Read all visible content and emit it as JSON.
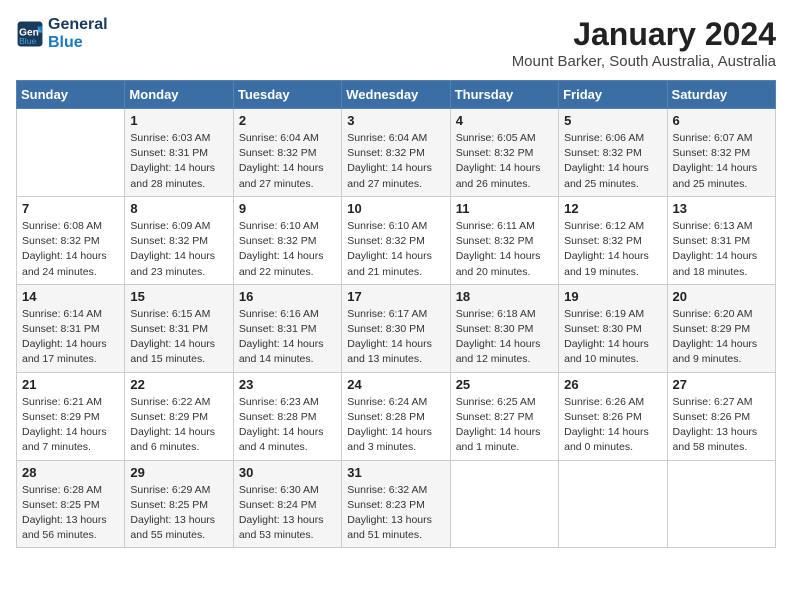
{
  "logo": {
    "line1": "General",
    "line2": "Blue"
  },
  "title": "January 2024",
  "location": "Mount Barker, South Australia, Australia",
  "headers": [
    "Sunday",
    "Monday",
    "Tuesday",
    "Wednesday",
    "Thursday",
    "Friday",
    "Saturday"
  ],
  "weeks": [
    [
      {
        "num": "",
        "info": ""
      },
      {
        "num": "1",
        "info": "Sunrise: 6:03 AM\nSunset: 8:31 PM\nDaylight: 14 hours\nand 28 minutes."
      },
      {
        "num": "2",
        "info": "Sunrise: 6:04 AM\nSunset: 8:32 PM\nDaylight: 14 hours\nand 27 minutes."
      },
      {
        "num": "3",
        "info": "Sunrise: 6:04 AM\nSunset: 8:32 PM\nDaylight: 14 hours\nand 27 minutes."
      },
      {
        "num": "4",
        "info": "Sunrise: 6:05 AM\nSunset: 8:32 PM\nDaylight: 14 hours\nand 26 minutes."
      },
      {
        "num": "5",
        "info": "Sunrise: 6:06 AM\nSunset: 8:32 PM\nDaylight: 14 hours\nand 25 minutes."
      },
      {
        "num": "6",
        "info": "Sunrise: 6:07 AM\nSunset: 8:32 PM\nDaylight: 14 hours\nand 25 minutes."
      }
    ],
    [
      {
        "num": "7",
        "info": "Sunrise: 6:08 AM\nSunset: 8:32 PM\nDaylight: 14 hours\nand 24 minutes."
      },
      {
        "num": "8",
        "info": "Sunrise: 6:09 AM\nSunset: 8:32 PM\nDaylight: 14 hours\nand 23 minutes."
      },
      {
        "num": "9",
        "info": "Sunrise: 6:10 AM\nSunset: 8:32 PM\nDaylight: 14 hours\nand 22 minutes."
      },
      {
        "num": "10",
        "info": "Sunrise: 6:10 AM\nSunset: 8:32 PM\nDaylight: 14 hours\nand 21 minutes."
      },
      {
        "num": "11",
        "info": "Sunrise: 6:11 AM\nSunset: 8:32 PM\nDaylight: 14 hours\nand 20 minutes."
      },
      {
        "num": "12",
        "info": "Sunrise: 6:12 AM\nSunset: 8:32 PM\nDaylight: 14 hours\nand 19 minutes."
      },
      {
        "num": "13",
        "info": "Sunrise: 6:13 AM\nSunset: 8:31 PM\nDaylight: 14 hours\nand 18 minutes."
      }
    ],
    [
      {
        "num": "14",
        "info": "Sunrise: 6:14 AM\nSunset: 8:31 PM\nDaylight: 14 hours\nand 17 minutes."
      },
      {
        "num": "15",
        "info": "Sunrise: 6:15 AM\nSunset: 8:31 PM\nDaylight: 14 hours\nand 15 minutes."
      },
      {
        "num": "16",
        "info": "Sunrise: 6:16 AM\nSunset: 8:31 PM\nDaylight: 14 hours\nand 14 minutes."
      },
      {
        "num": "17",
        "info": "Sunrise: 6:17 AM\nSunset: 8:30 PM\nDaylight: 14 hours\nand 13 minutes."
      },
      {
        "num": "18",
        "info": "Sunrise: 6:18 AM\nSunset: 8:30 PM\nDaylight: 14 hours\nand 12 minutes."
      },
      {
        "num": "19",
        "info": "Sunrise: 6:19 AM\nSunset: 8:30 PM\nDaylight: 14 hours\nand 10 minutes."
      },
      {
        "num": "20",
        "info": "Sunrise: 6:20 AM\nSunset: 8:29 PM\nDaylight: 14 hours\nand 9 minutes."
      }
    ],
    [
      {
        "num": "21",
        "info": "Sunrise: 6:21 AM\nSunset: 8:29 PM\nDaylight: 14 hours\nand 7 minutes."
      },
      {
        "num": "22",
        "info": "Sunrise: 6:22 AM\nSunset: 8:29 PM\nDaylight: 14 hours\nand 6 minutes."
      },
      {
        "num": "23",
        "info": "Sunrise: 6:23 AM\nSunset: 8:28 PM\nDaylight: 14 hours\nand 4 minutes."
      },
      {
        "num": "24",
        "info": "Sunrise: 6:24 AM\nSunset: 8:28 PM\nDaylight: 14 hours\nand 3 minutes."
      },
      {
        "num": "25",
        "info": "Sunrise: 6:25 AM\nSunset: 8:27 PM\nDaylight: 14 hours\nand 1 minute."
      },
      {
        "num": "26",
        "info": "Sunrise: 6:26 AM\nSunset: 8:26 PM\nDaylight: 14 hours\nand 0 minutes."
      },
      {
        "num": "27",
        "info": "Sunrise: 6:27 AM\nSunset: 8:26 PM\nDaylight: 13 hours\nand 58 minutes."
      }
    ],
    [
      {
        "num": "28",
        "info": "Sunrise: 6:28 AM\nSunset: 8:25 PM\nDaylight: 13 hours\nand 56 minutes."
      },
      {
        "num": "29",
        "info": "Sunrise: 6:29 AM\nSunset: 8:25 PM\nDaylight: 13 hours\nand 55 minutes."
      },
      {
        "num": "30",
        "info": "Sunrise: 6:30 AM\nSunset: 8:24 PM\nDaylight: 13 hours\nand 53 minutes."
      },
      {
        "num": "31",
        "info": "Sunrise: 6:32 AM\nSunset: 8:23 PM\nDaylight: 13 hours\nand 51 minutes."
      },
      {
        "num": "",
        "info": ""
      },
      {
        "num": "",
        "info": ""
      },
      {
        "num": "",
        "info": ""
      }
    ]
  ]
}
